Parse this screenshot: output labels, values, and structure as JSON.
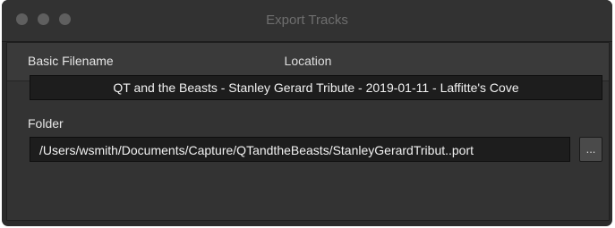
{
  "window": {
    "title": "Export Tracks"
  },
  "panel": {
    "header": "Location"
  },
  "basic_filename": {
    "label": "Basic Filename",
    "value": "QT and the Beasts - Stanley Gerard Tribute - 2019-01-11 - Laffitte's Cove"
  },
  "folder": {
    "label": "Folder",
    "value": "/Users/wsmith/Documents/Capture/QTandtheBeasts/StanleyGerardTribut..port",
    "browse_label": "..."
  },
  "icons": {
    "traffic_lights": [
      "close-icon",
      "minimize-icon",
      "zoom-icon"
    ]
  },
  "colors": {
    "window_bg": "#2b2b2b",
    "titlebar_bg": "#323232",
    "field_bg": "#1d1d1d",
    "traffic_inactive": "#5f5f5f"
  }
}
